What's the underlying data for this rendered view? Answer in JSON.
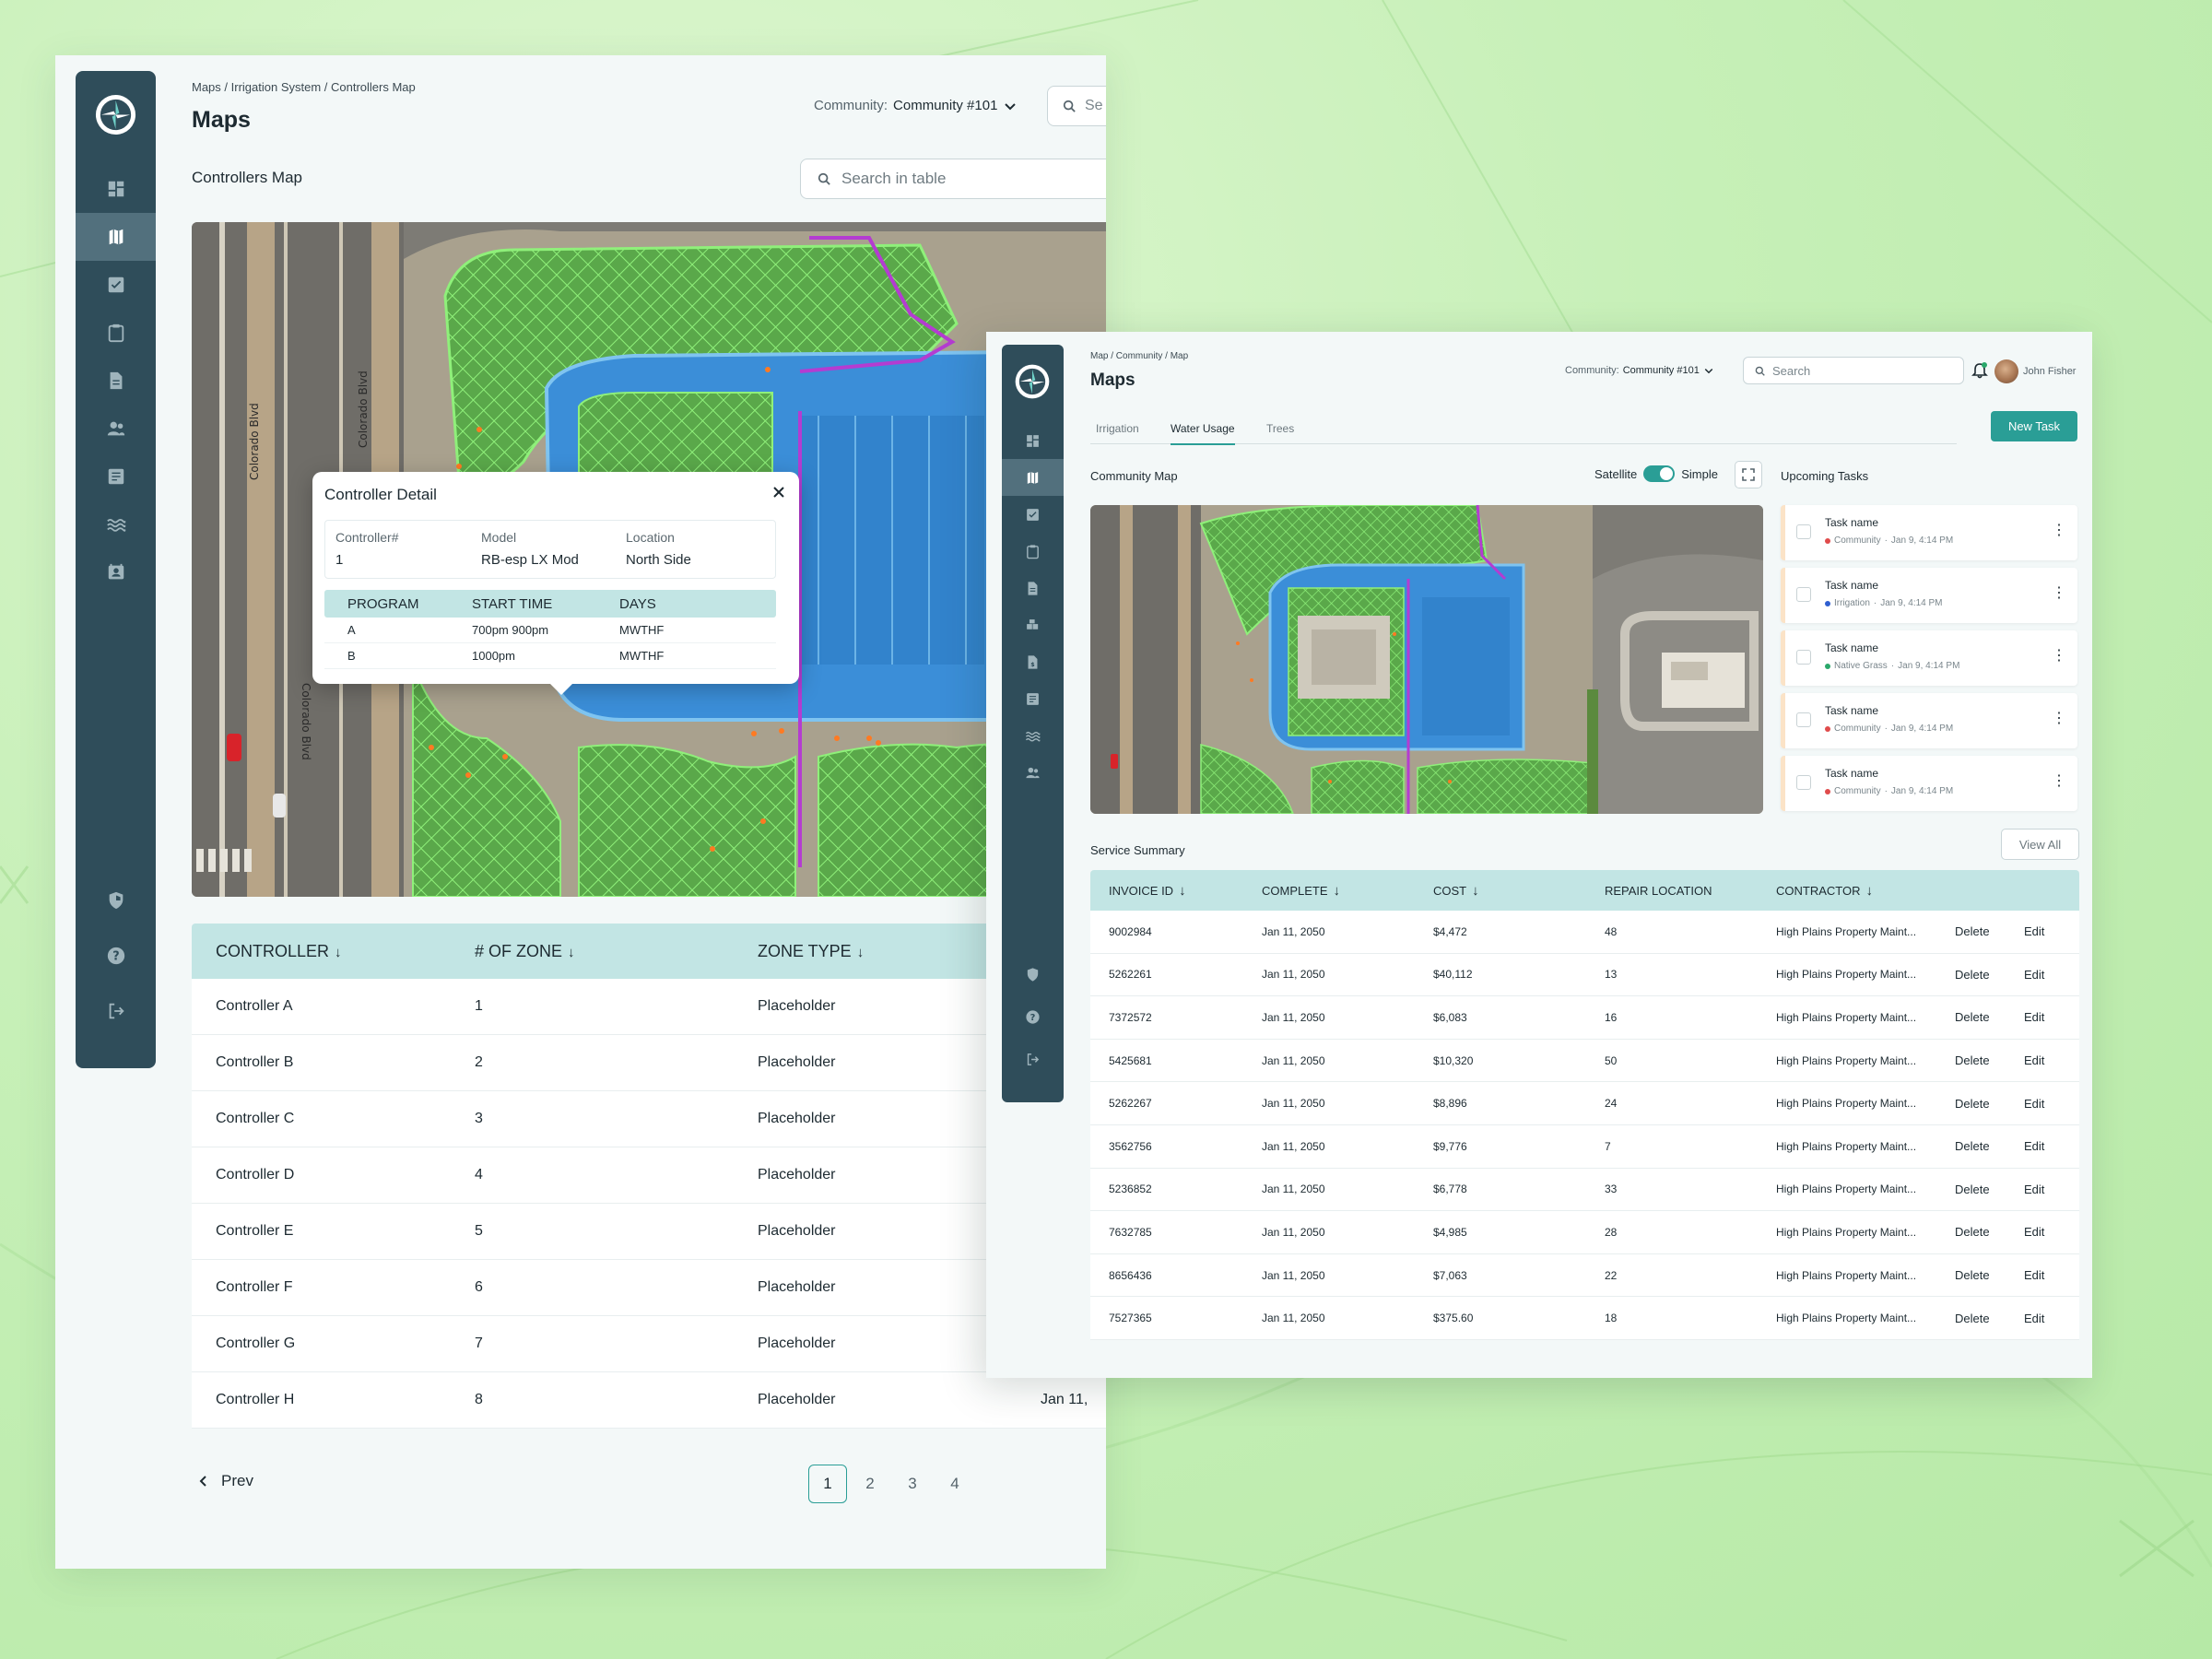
{
  "win1": {
    "breadcrumb": "Maps / Irrigation System / Controllers Map",
    "title": "Maps",
    "community_label": "Community:",
    "community_value": "Community #101",
    "search_top_placeholder": "Se",
    "section_title": "Controllers Map",
    "search_table_placeholder": "Search in table",
    "map_labels": {
      "street1": "Colorado Blvd",
      "street2": "Colorado Blvd",
      "street3": "Colorado Blvd"
    },
    "popup": {
      "title": "Controller Detail",
      "info_headers": [
        "Controller#",
        "Model",
        "Location"
      ],
      "info_values": [
        "1",
        "RB-esp LX Mod",
        "North Side"
      ],
      "table_headers": [
        "PROGRAM",
        "START TIME",
        "DAYS"
      ],
      "rows": [
        [
          "A",
          "700pm 900pm",
          "MWTHF"
        ],
        [
          "B",
          "1000pm",
          "MWTHF"
        ]
      ]
    },
    "table": {
      "headers": [
        "CONTROLLER",
        "# OF ZONE",
        "ZONE TYPE"
      ],
      "rows": [
        [
          "Controller A",
          "1",
          "Placeholder",
          ""
        ],
        [
          "Controller B",
          "2",
          "Placeholder",
          ""
        ],
        [
          "Controller C",
          "3",
          "Placeholder",
          ""
        ],
        [
          "Controller D",
          "4",
          "Placeholder",
          ""
        ],
        [
          "Controller E",
          "5",
          "Placeholder",
          ""
        ],
        [
          "Controller F",
          "6",
          "Placeholder",
          ""
        ],
        [
          "Controller G",
          "7",
          "Placeholder",
          ""
        ],
        [
          "Controller H",
          "8",
          "Placeholder",
          "Jan 11,"
        ]
      ]
    },
    "pager": {
      "prev": "Prev",
      "pages": [
        "1",
        "2",
        "3",
        "4"
      ],
      "current": "1"
    }
  },
  "win2": {
    "breadcrumb": "Map / Community / Map",
    "title": "Maps",
    "community_label": "Community:",
    "community_value": "Community #101",
    "search_placeholder": "Search",
    "user_name": "John Fisher",
    "tabs": [
      "Irrigation",
      "Water Usage",
      "Trees"
    ],
    "active_tab": "Water Usage",
    "new_task": "New Task",
    "map_title": "Community Map",
    "toggle_left": "Satellite",
    "toggle_right": "Simple",
    "tasks_title": "Upcoming Tasks",
    "tasks": [
      {
        "name": "Task name",
        "category": "Community",
        "color": "#e04b4b",
        "time": "Jan 9, 4:14 PM"
      },
      {
        "name": "Task name",
        "category": "Irrigation",
        "color": "#2f5fd0",
        "time": "Jan 9, 4:14 PM"
      },
      {
        "name": "Task name",
        "category": "Native Grass",
        "color": "#2aa86b",
        "time": "Jan 9, 4:14 PM"
      },
      {
        "name": "Task name",
        "category": "Community",
        "color": "#e04b4b",
        "time": "Jan 9, 4:14 PM"
      },
      {
        "name": "Task name",
        "category": "Community",
        "color": "#e04b4b",
        "time": "Jan 9, 4:14 PM"
      }
    ],
    "service_title": "Service Summary",
    "view_all": "View All",
    "table": {
      "headers": [
        "INVOICE ID",
        "COMPLETE",
        "COST",
        "REPAIR LOCATION",
        "CONTRACTOR"
      ],
      "delete_label": "Delete",
      "edit_label": "Edit",
      "rows": [
        [
          "9002984",
          "Jan 11, 2050",
          "$4,472",
          "48",
          "High Plains Property Maint..."
        ],
        [
          "5262261",
          "Jan 11, 2050",
          "$40,112",
          "13",
          "High Plains Property Maint..."
        ],
        [
          "7372572",
          "Jan 11, 2050",
          "$6,083",
          "16",
          "High Plains Property Maint..."
        ],
        [
          "5425681",
          "Jan 11, 2050",
          "$10,320",
          "50",
          "High Plains Property Maint..."
        ],
        [
          "5262267",
          "Jan 11, 2050",
          "$8,896",
          "24",
          "High Plains Property Maint..."
        ],
        [
          "3562756",
          "Jan 11, 2050",
          "$9,776",
          "7",
          "High Plains Property Maint..."
        ],
        [
          "5236852",
          "Jan 11, 2050",
          "$6,778",
          "33",
          "High Plains Property Maint..."
        ],
        [
          "7632785",
          "Jan 11, 2050",
          "$4,985",
          "28",
          "High Plains Property Maint..."
        ],
        [
          "8656436",
          "Jan 11, 2050",
          "$7,063",
          "22",
          "High Plains Property Maint..."
        ],
        [
          "7527365",
          "Jan 11, 2050",
          "$375.60",
          "18",
          "High Plains Property Maint..."
        ]
      ]
    }
  },
  "colors": {
    "accent": "#2a9e96",
    "sidebar": "#2f4d5a",
    "table_header": "#c2e5e4",
    "task_border": "#fbe3c7"
  }
}
